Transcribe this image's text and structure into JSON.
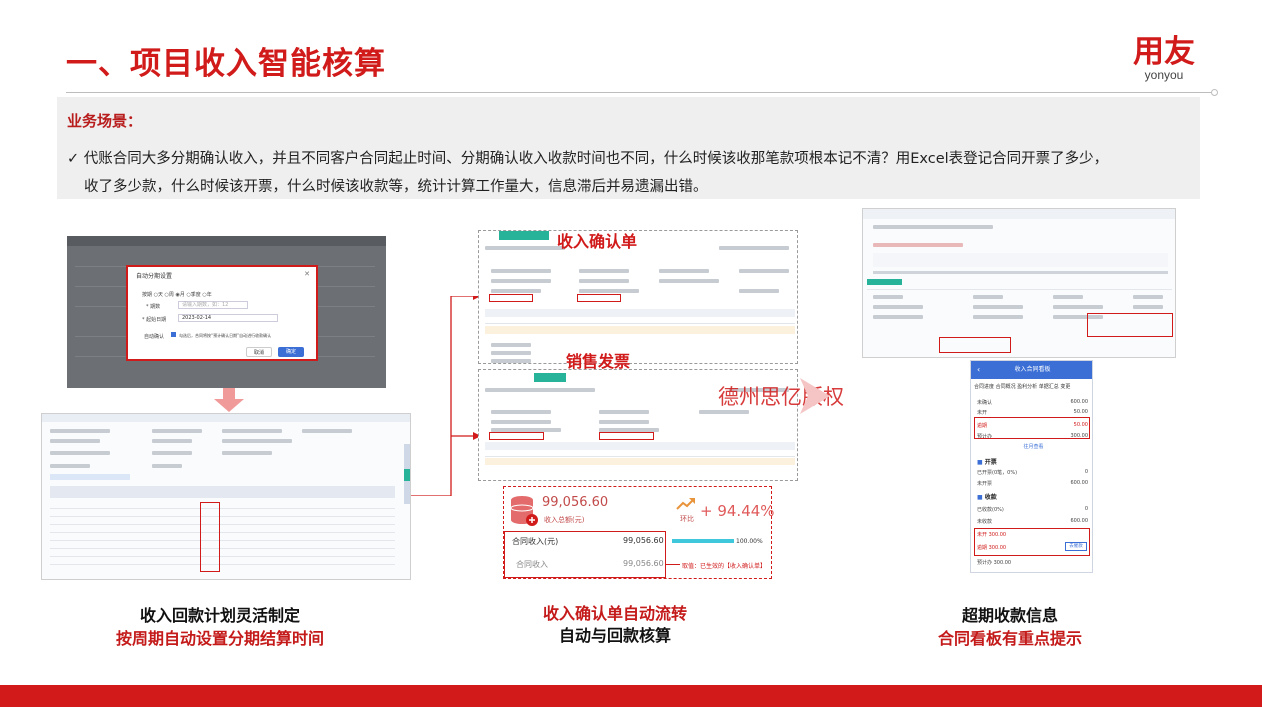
{
  "header": {
    "title": "一、项目收入智能核算",
    "brand_cn": "用友",
    "brand_en": "yonyou"
  },
  "scene": {
    "label": "业务场景：",
    "check": "✓",
    "line1": "代账合同大多分期确认收入，并且不同客户合同起止时间、分期确认收入收款时间也不同，什么时候该收那笔款项根本记不清？用Excel表登记合同开票了多少，",
    "line2": "收了多少款，什么时候该开票，什么时候该收款等，统计计算工作量大，信息滞后并易遗漏出错。"
  },
  "panel_left": {
    "dialog_title": "自动分期设置",
    "radios": "按期 ○天 ○周 ◉月 ○季度 ○年",
    "period_label": "* 期数",
    "period_placeholder": "请输入期数，如：12",
    "start_label": "* 起始日期",
    "start_value": "2023-02-14",
    "auto_label": "自动确认",
    "auto_text": "勾选后，合同将按“预计确认日期”自动进行收款确认",
    "cancel": "取消",
    "confirm": "确定",
    "caption_black": "收入回款计划灵活制定",
    "caption_red": "按周期自动设置分期结算时间"
  },
  "panel_mid": {
    "callout_top": "收入确认单",
    "callout_mid": "销售发票",
    "watermark": "德州思亿版权",
    "kpi_amount": "99,056.60",
    "kpi_amount_label": "收入总额(元)",
    "kpi_trend_label": "环比",
    "kpi_rate": "+ 94.44%",
    "row1_label": "合同收入(元)",
    "row1_value": "99,056.60",
    "row1_pct": "100.00%",
    "row2_label": "合同收入",
    "row2_value": "99,056.60",
    "row2_note": "取值：已生效的【收入确认单】",
    "caption_red": "收入确认单自动流转",
    "caption_black": "自动与回款核算"
  },
  "panel_right": {
    "phone_title": "收入合同看板",
    "phone_tabs": "合同进度  合同概况  盈利分析  单据汇总  变更",
    "rows": [
      {
        "label": "未确认",
        "value": "600.00"
      },
      {
        "label": "未开",
        "value": "50.00"
      },
      {
        "label": "逾期",
        "value": "50.00"
      },
      {
        "label": "预计办",
        "value": "300.00"
      }
    ],
    "expand": "往月查看",
    "sec_invoice": "开票",
    "invoice_rows": [
      {
        "label": "已开票(0笔，0%)",
        "value": "0"
      },
      {
        "label": "未开票",
        "value": "600.00"
      }
    ],
    "sec_collect": "收款",
    "collect_rows": [
      {
        "label": "已收款(0%)",
        "value": "0"
      },
      {
        "label": "未收款",
        "value": "600.00"
      }
    ],
    "overdue_a": "未开 300.00",
    "overdue_b": "逾期 300.00",
    "remind": "去催款",
    "forecast": "预计办  300.00",
    "caption_black": "超期收款信息",
    "caption_red": "合同看板有重点提示"
  },
  "colors": {
    "brand_red": "#d11a1a",
    "accent_blue": "#3b6fd6",
    "teal": "#27b39a"
  }
}
